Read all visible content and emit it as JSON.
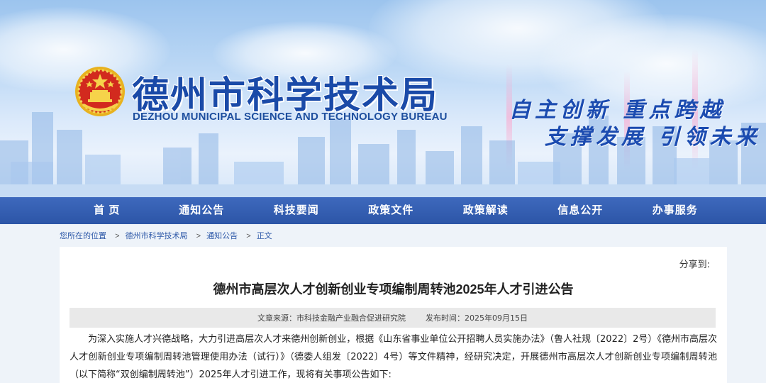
{
  "header": {
    "title": "德州市科学技术局",
    "subtitle": "DEZHOU MUNICIPAL SCIENCE AND TECHNOLOGY BUREAU",
    "slogan_line1": "自主创新  重点跨越",
    "slogan_line2": "支撑发展  引领未来",
    "emblem_icon": "national-emblem-icon"
  },
  "nav": {
    "items": [
      {
        "label": "首 页"
      },
      {
        "label": "通知公告"
      },
      {
        "label": "科技要闻"
      },
      {
        "label": "政策文件"
      },
      {
        "label": "政策解读"
      },
      {
        "label": "信息公开"
      },
      {
        "label": "办事服务"
      }
    ]
  },
  "breadcrumb": {
    "prefix": "您所在的位置",
    "items": [
      "德州市科学技术局",
      "通知公告",
      "正文"
    ],
    "separator": ">"
  },
  "article": {
    "share_label": "分享到:",
    "title": "德州市高层次人才创新创业专项编制周转池2025年人才引进公告",
    "source": "文章来源：市科技金融产业融合促进研究院",
    "publish_time": "发布时间：2025年09月15日",
    "body": "为深入实施人才兴德战略，大力引进高层次人才来德州创新创业，根据《山东省事业单位公开招聘人员实施办法》（鲁人社规〔2022〕2号）《德州市高层次人才创新创业专项编制周转池管理使用办法（试行）》（德委人组发〔2022〕4号）等文件精神，经研究决定，开展德州市高层次人才创新创业专项编制周转池（以下简称“双创编制周转池”）2025年人才引进工作，现将有关事项公告如下:"
  },
  "colors": {
    "nav_bg": "#2c55a7",
    "title_blue": "#1a4aa8",
    "link_blue": "#2d58a8",
    "meta_bg": "#e9e9e9"
  }
}
